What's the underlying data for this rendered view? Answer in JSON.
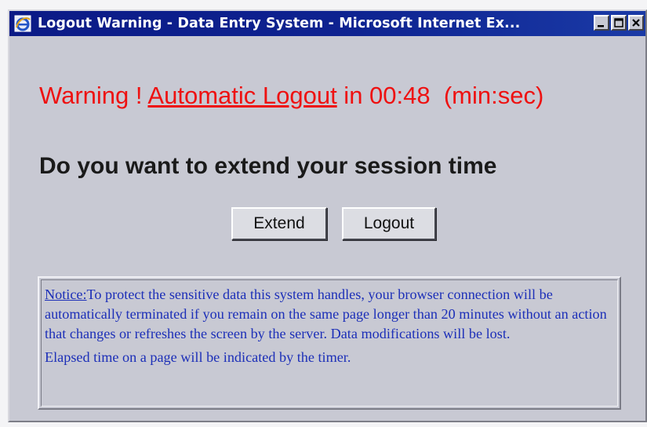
{
  "window": {
    "title": "Logout Warning - Data Entry System - Microsoft Internet Ex...",
    "controls": [
      "minimize-icon",
      "maximize-icon",
      "close-icon"
    ]
  },
  "warning": {
    "prefix": "Warning ! ",
    "link_text": "Automatic Logout",
    "middle": " in ",
    "countdown": "00:48",
    "suffix": "  (min:sec)"
  },
  "question": "Do you want to extend your session time",
  "buttons": {
    "extend_label": "Extend",
    "logout_label": "Logout"
  },
  "notice": {
    "label": "Notice:",
    "body": "To protect the sensitive data  this system handles, your browser connection will be automatically  terminated if you remain on the same page longer than 20 minutes  without an action that  changes or refreshes the screen by the server. Data modifications will be  lost.",
    "elapsed": "Elapsed time on a page will be indicated by the  timer."
  },
  "colors": {
    "warning_text": "#ee1111",
    "notice_text": "#1c2fb8",
    "titlebar": "#0b1a86",
    "background": "#c8c9d3"
  }
}
